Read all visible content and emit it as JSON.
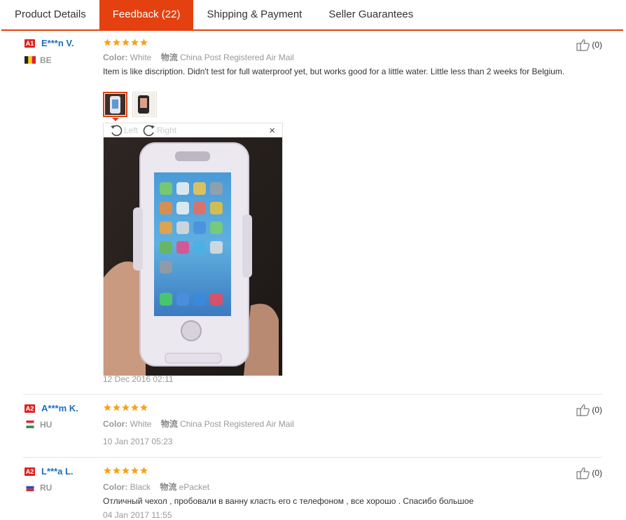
{
  "tabs": [
    "Product Details",
    "Feedback (22)",
    "Shipping & Payment",
    "Seller Guarantees"
  ],
  "ship_label": "物流",
  "color_label": "Color:",
  "viewer": {
    "left_label": "Left",
    "right_label": "Right",
    "close": "×"
  },
  "reviews": [
    {
      "level": "A1",
      "name": "E***n V.",
      "country": "BE",
      "color": "White",
      "shipping": "China Post Registered Air Mail",
      "text": "Item is like discription. Didn't test for full waterproof yet, but works good for a little water. Little less than 2 weeks for Belgium.",
      "date": "12 Dec 2016 02:11",
      "helpful": "(0)",
      "stars": 5
    },
    {
      "level": "A2",
      "name": "A***m K.",
      "country": "HU",
      "color": "White",
      "shipping": "China Post Registered Air Mail",
      "text": "",
      "date": "10 Jan 2017 05:23",
      "helpful": "(0)",
      "stars": 5
    },
    {
      "level": "A2",
      "name": "L***a L.",
      "country": "RU",
      "color": "Black",
      "shipping": "ePacket",
      "text": "Отличный чехол , пробовали в ванну класть его с телефоном , все хорошо . Спасибо большое",
      "date": "04 Jan 2017 11:55",
      "helpful": "(0)",
      "stars": 5
    }
  ],
  "colors": {
    "accent": "#e5400f",
    "star": "#f7a21b",
    "link": "#1a6fc4"
  }
}
